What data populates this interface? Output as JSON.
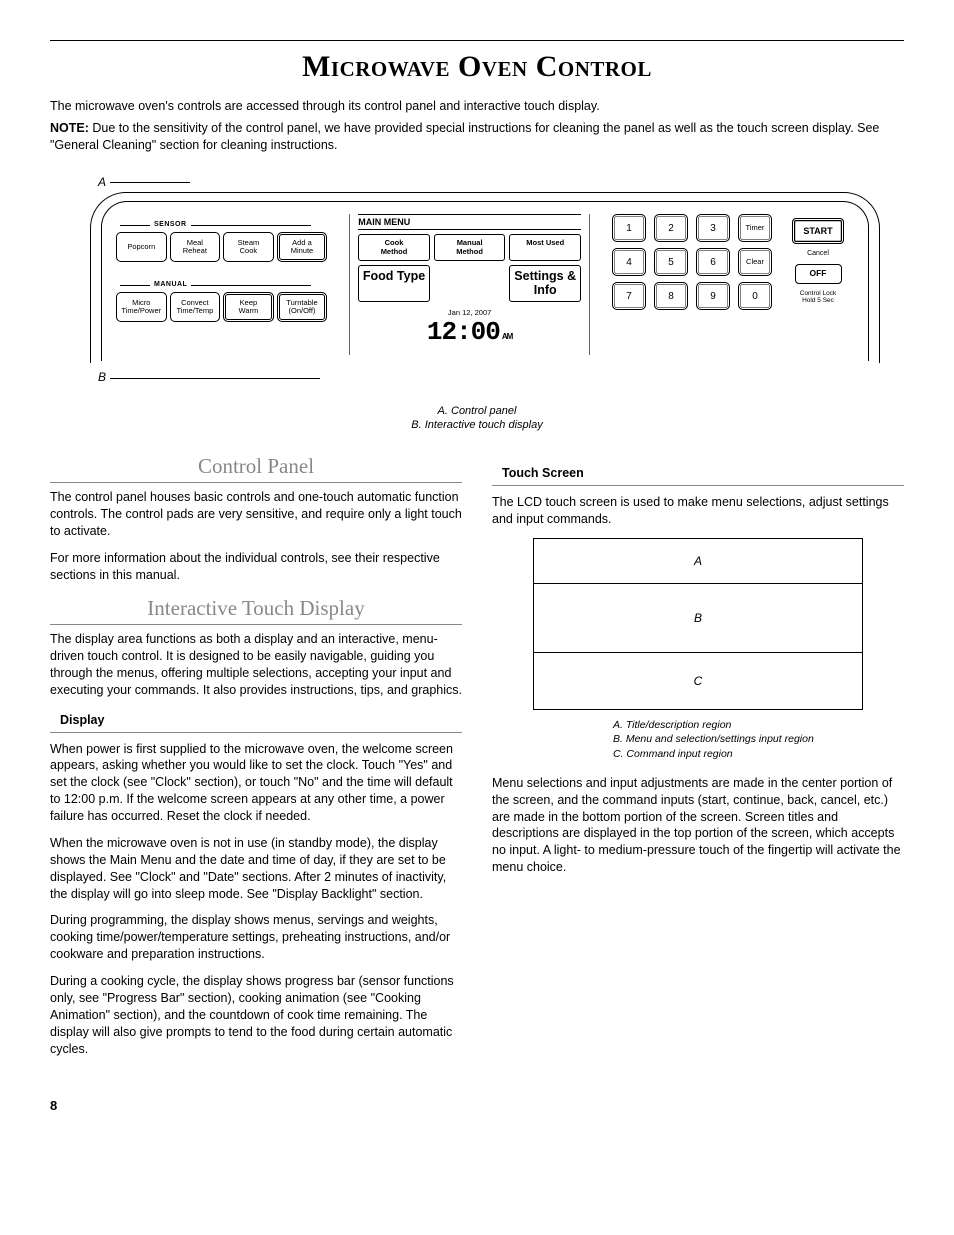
{
  "title": "Microwave Oven Control",
  "intro": {
    "p1": "The microwave oven's controls are accessed through its control panel and interactive touch display.",
    "note_label": "NOTE:",
    "note_text": " Due to the sensitivity of the control panel, we have provided special instructions for cleaning the panel as well as the touch screen display. See \"General Cleaning\" section for cleaning instructions."
  },
  "figure": {
    "label_a": "A",
    "label_b": "B",
    "sensor_label": "SENSOR",
    "manual_label": "MANUAL",
    "sensor_buttons": [
      "Popcorn",
      "Meal\nReheat",
      "Steam\nCook",
      "Add a\nMinute"
    ],
    "manual_buttons": [
      "Micro\nTime/Power",
      "Convect\nTime/Temp",
      "Keep\nWarm",
      "Turntable\n(On/Off)"
    ],
    "menu_title": "MAIN MENU",
    "menu_r1": [
      "Cook\nMethod",
      "Manual\nMethod",
      "Most Used"
    ],
    "menu_r2": [
      "Food Type",
      "",
      "Settings &\nInfo"
    ],
    "date": "Jan 12, 2007",
    "time": "12:00",
    "ampm": "AM",
    "keypad": [
      "1",
      "2",
      "3",
      "Timer",
      "4",
      "5",
      "6",
      "Clear",
      "7",
      "8",
      "9",
      "0"
    ],
    "start": "START",
    "cancel": "Cancel",
    "off": "OFF",
    "lock": "Control Lock\nHold 5 Sec"
  },
  "caption": {
    "a": "A. Control panel",
    "b": "B. Interactive touch display"
  },
  "section1": {
    "heading": "Control Panel",
    "p1": "The control panel houses basic controls and one-touch automatic function controls. The control pads are very sensitive, and require only a light touch to activate.",
    "p2": "For more information about the individual controls, see their respective sections in this manual."
  },
  "section2": {
    "heading": "Interactive Touch Display",
    "p1": "The display area functions as both a display and an interactive, menu-driven touch control. It is designed to be easily navigable, guiding you through the menus, offering multiple selections, accepting your input and executing your commands. It also provides instructions, tips, and graphics."
  },
  "display": {
    "heading": "Display",
    "p1": "When power is first supplied to the microwave oven, the welcome screen appears, asking whether you would like to set the clock. Touch \"Yes\" and set the clock (see \"Clock\" section), or touch \"No\" and the time will default to 12:00 p.m. If the welcome screen appears at any other time, a power failure has occurred. Reset the clock if needed.",
    "p2": "When the microwave oven is not in use (in standby mode), the display shows the Main Menu and the date and time of day, if they are set to be displayed. See \"Clock\" and \"Date\" sections. After 2 minutes of inactivity, the display will go into sleep mode. See \"Display Backlight\" section.",
    "p3": "During programming, the display shows menus, servings and weights, cooking time/power/temperature settings, preheating instructions, and/or cookware and preparation instructions.",
    "p4": "During a cooking cycle, the display shows progress bar (sensor functions only, see \"Progress Bar\" section), cooking animation (see \"Cooking Animation\" section), and the countdown of cook time remaining. The display will also give prompts to tend to the food during certain automatic cycles."
  },
  "touch": {
    "heading": "Touch Screen",
    "p1": "The LCD touch screen is used to make menu selections, adjust settings and input commands.",
    "region_a": "A",
    "region_b": "B",
    "region_c": "C",
    "cap_a": "A. Title/description region",
    "cap_b": "B. Menu and selection/settings input region",
    "cap_c": "C. Command input region",
    "p2": "Menu selections and input adjustments are made in the center portion of the screen, and the command inputs (start, continue, back, cancel, etc.) are made in the bottom portion of the screen. Screen titles and descriptions are displayed in the top portion of the screen, which accepts no input. A light- to medium-pressure touch of the fingertip will activate the menu choice."
  },
  "pagenum": "8"
}
